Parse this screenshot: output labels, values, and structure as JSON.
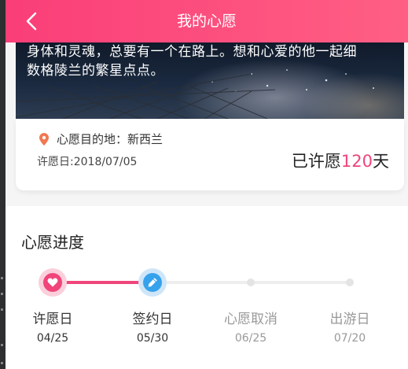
{
  "header": {
    "title": "我的心愿",
    "back_icon": "chevron-left-icon"
  },
  "hero": {
    "description": "身体和灵魂，总要有一个在路上。想和心爱的他一起细\n数格陵兰的繁星点点。"
  },
  "wish_card": {
    "destination_label": "心愿目的地：新西兰",
    "wish_date_label": "许愿日:2018/07/05",
    "days_prefix": "已许愿",
    "days_count": "120",
    "days_suffix": "天"
  },
  "progress": {
    "title": "心愿进度",
    "steps": [
      {
        "label": "许愿日",
        "date": "04/25",
        "state": "done",
        "icon": "heart-icon"
      },
      {
        "label": "签约日",
        "date": "05/30",
        "state": "current",
        "icon": "pen-icon"
      },
      {
        "label": "心愿取消",
        "date": "06/25",
        "state": "pending"
      },
      {
        "label": "出游日",
        "date": "07/20",
        "state": "pending"
      }
    ]
  },
  "colors": {
    "accent": "#f0457a",
    "header_gradient": [
      "#fa3e78",
      "#ff5f84"
    ],
    "step_blue": "#37a2ec"
  }
}
